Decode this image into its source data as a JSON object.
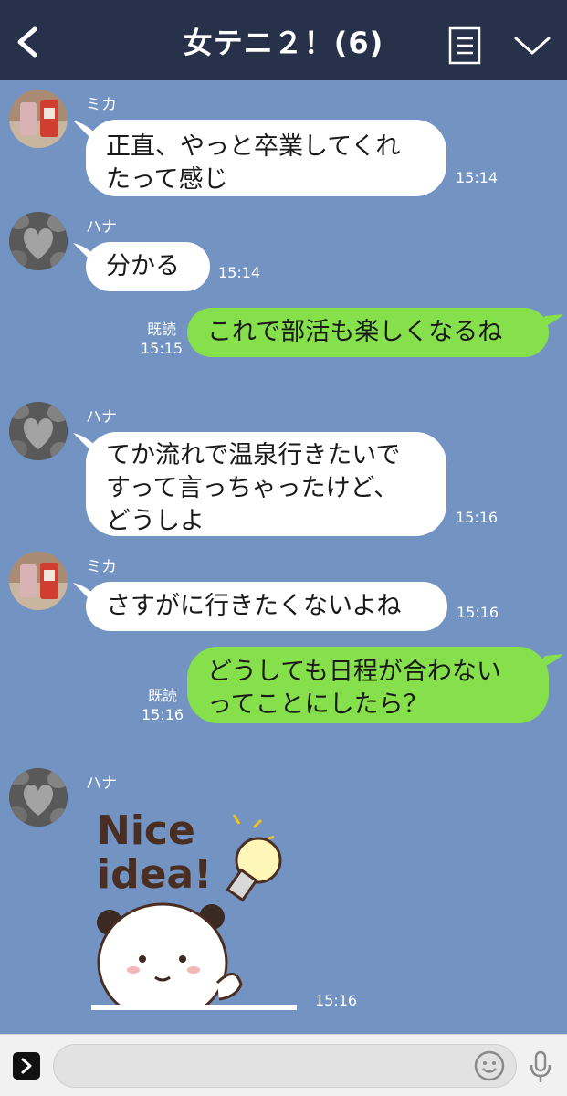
{
  "header": {
    "title": "女テニ２！",
    "count": "(6)"
  },
  "messages": [
    {
      "sender": "ミカ",
      "text1": "正直、やっと卒業してくれ",
      "text2": "たって感じ",
      "time": "15:14"
    },
    {
      "sender": "ハナ",
      "text1": "分かる",
      "time": "15:14"
    },
    {
      "read": "既読",
      "time": "15:15",
      "text1": "これで部活も楽しくなるね"
    },
    {
      "sender": "ハナ",
      "text1": "てか流れで温泉行きたいで",
      "text2": "すって言っちゃったけど、",
      "text3": "どうしよ",
      "time": "15:16"
    },
    {
      "sender": "ミカ",
      "text1": "さすがに行きたくないよね",
      "time": "15:16"
    },
    {
      "read": "既読",
      "time": "15:16",
      "text1": "どうしても日程が合わない",
      "text2": "ってことにしたら？"
    },
    {
      "sender": "ハナ",
      "sticker_text1": "Nice",
      "sticker_text2": "idea!",
      "time": "15:16"
    }
  ],
  "input": {
    "placeholder": ""
  }
}
